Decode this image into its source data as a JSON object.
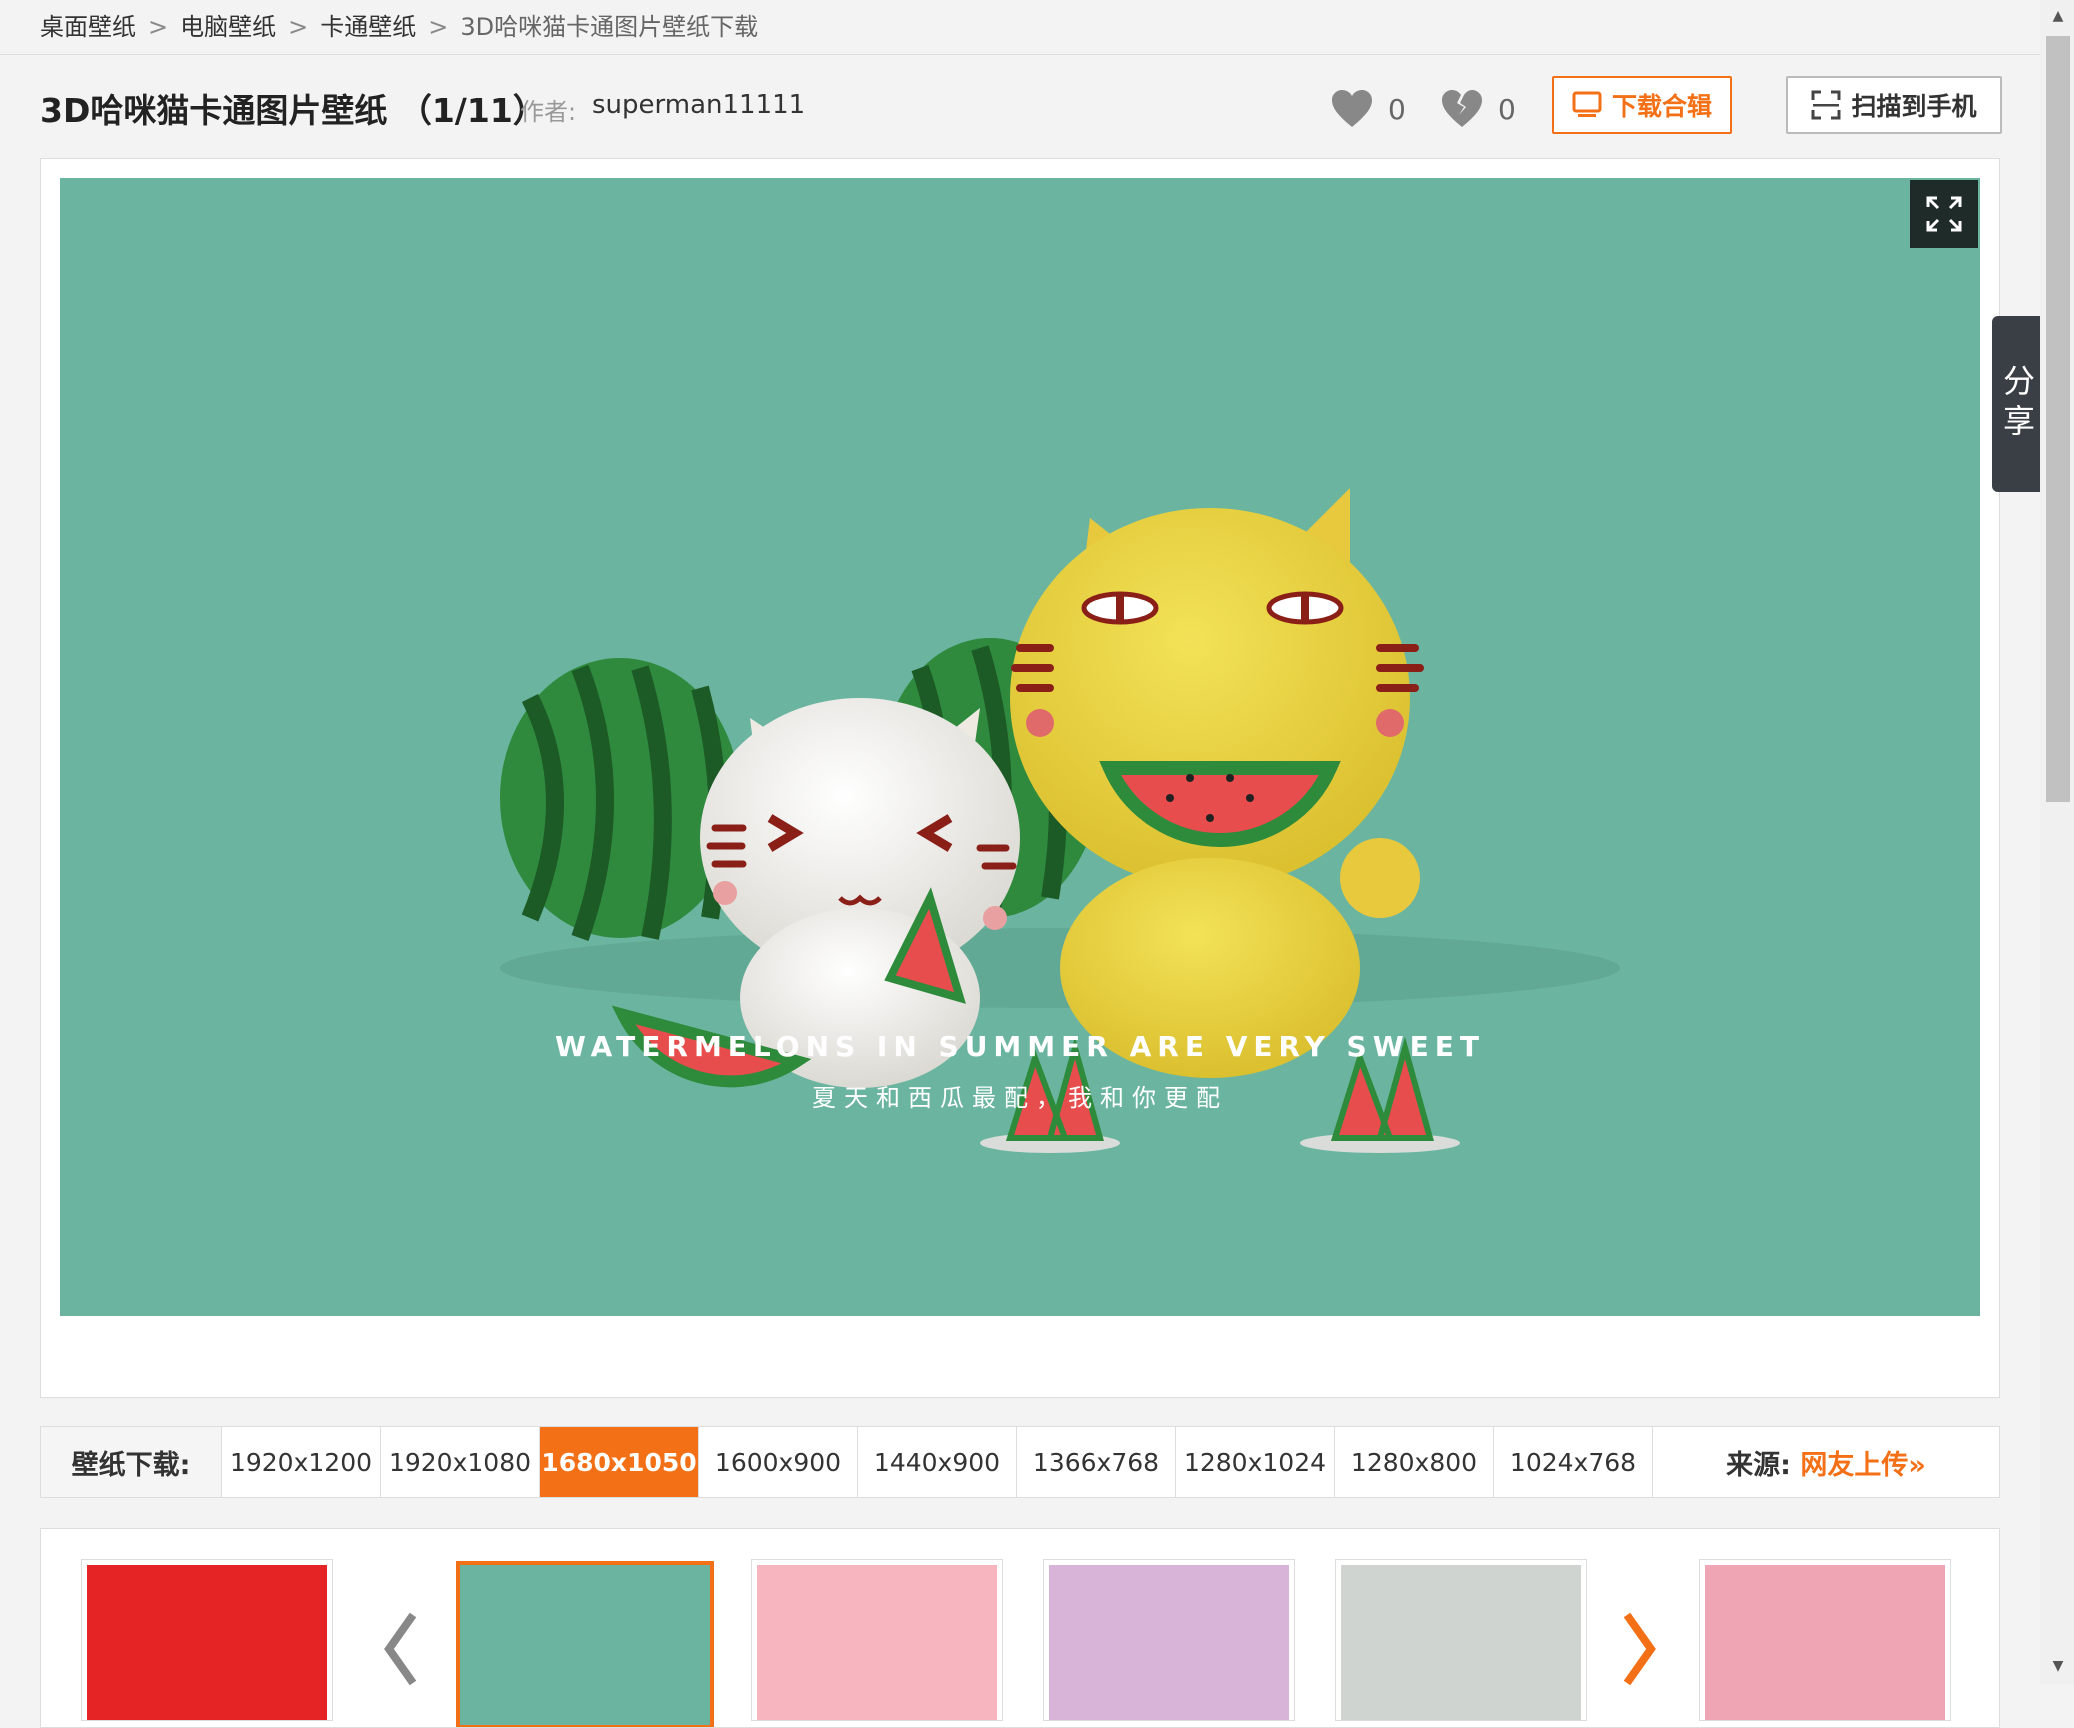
{
  "breadcrumb": {
    "items": [
      "桌面壁纸",
      "电脑壁纸",
      "卡通壁纸"
    ],
    "current": "3D哈咪猫卡通图片壁纸下载",
    "separator": ">"
  },
  "header": {
    "title": "3D哈咪猫卡通图片壁纸 （1/11）",
    "author_label": "作者:",
    "author": "superman11111",
    "like_count": "0",
    "dislike_count": "0",
    "download_album_label": "下载合辑",
    "scan_label": "扫描到手机"
  },
  "wallpaper": {
    "text_en": "WATERMELONS IN SUMMER ARE VERY SWEET",
    "text_cn": "夏天和西瓜最配，我和你更配"
  },
  "share": {
    "label": "分享"
  },
  "download_bar": {
    "label": "壁纸下载:",
    "resolutions": [
      "1920x1200",
      "1920x1080",
      "1680x1050",
      "1600x900",
      "1440x900",
      "1366x768",
      "1280x1024",
      "1280x800",
      "1024x768"
    ],
    "active": "1680x1050",
    "source_label": "来源:",
    "source_link": "网友上传»"
  },
  "colors": {
    "accent": "#f47016",
    "wallpaper_bg": "#6bb5a0"
  },
  "icons": [
    "heart-icon",
    "broken-heart-icon",
    "monitor-icon",
    "scan-icon",
    "fullscreen-icon",
    "chevron-left-icon",
    "chevron-right-icon"
  ]
}
